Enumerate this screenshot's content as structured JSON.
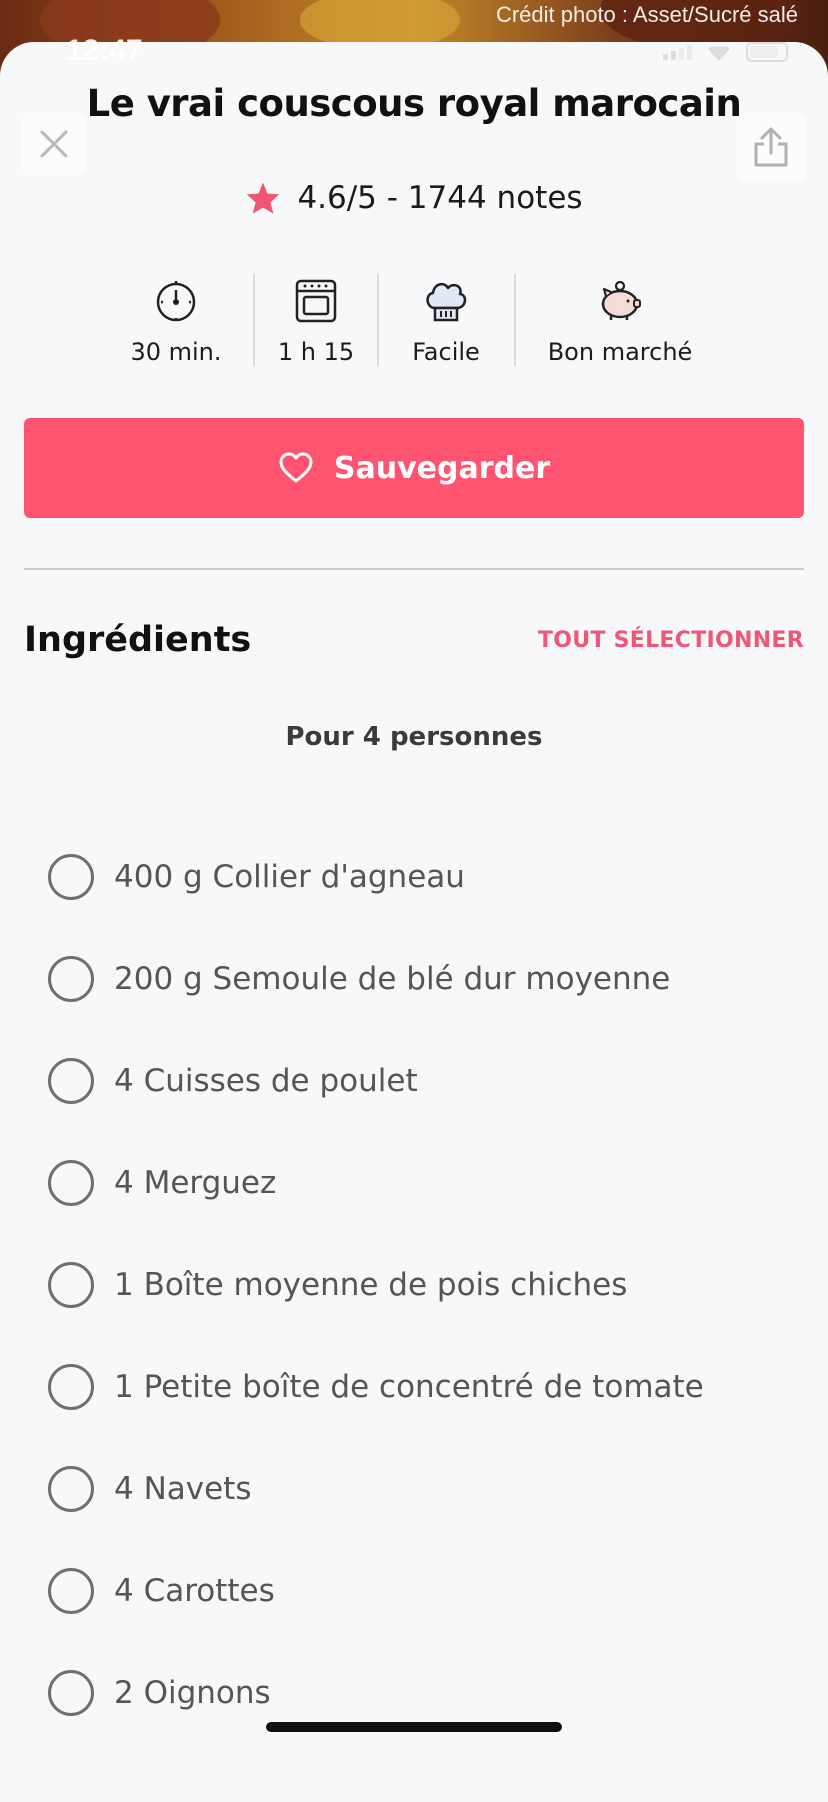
{
  "hero": {
    "credit": "Crédit photo : Asset/Sucré salé"
  },
  "status_bar": {
    "time": "12:47"
  },
  "recipe": {
    "title": "Le vrai couscous royal marocain",
    "rating_text": "4.6/5 - 1744 notes",
    "rating_icon": "star-icon",
    "info": [
      {
        "icon": "timer-icon",
        "label": "30 min."
      },
      {
        "icon": "oven-icon",
        "label": "1 h 15"
      },
      {
        "icon": "chef-hat-icon",
        "label": "Facile"
      },
      {
        "icon": "piggy-bank-icon",
        "label": "Bon marché"
      }
    ],
    "save_label": "Sauvegarder"
  },
  "ingredients": {
    "title": "Ingrédients",
    "select_all": "TOUT SÉLECTIONNER",
    "persons": "Pour 4 personnes",
    "items": [
      "400 g Collier d'agneau",
      "200 g Semoule de blé dur moyenne",
      "4 Cuisses de poulet",
      "4 Merguez",
      "1 Boîte moyenne de pois chiches",
      "1 Petite boîte de concentré de tomate",
      "4 Navets",
      "4 Carottes",
      "2 Oignons"
    ]
  },
  "colors": {
    "accent": "#ff5470",
    "accent_text": "#f0567a",
    "star": "#f0566f",
    "background": "#f7f8fa"
  }
}
